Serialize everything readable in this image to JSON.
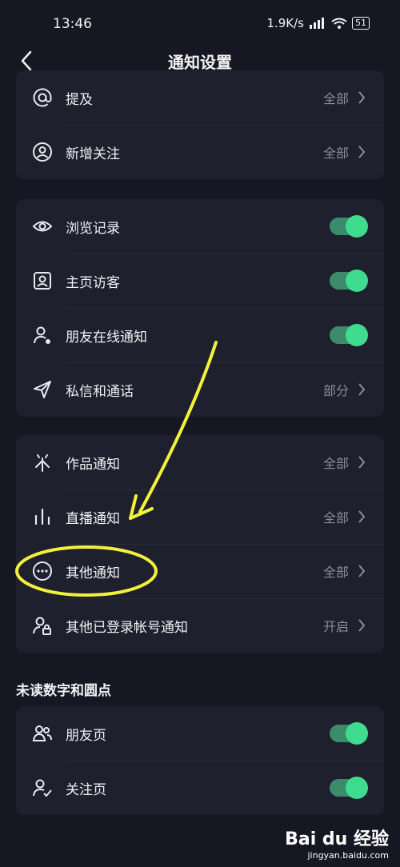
{
  "status": {
    "time": "13:46",
    "speed": "1.9K/s",
    "battery": "51"
  },
  "nav": {
    "title": "通知设置"
  },
  "group1": [
    {
      "label": "提及",
      "value": "全部",
      "icon": "at-icon"
    },
    {
      "label": "新增关注",
      "value": "全部",
      "icon": "user-circle-icon"
    }
  ],
  "group2": [
    {
      "label": "浏览记录",
      "toggle": true,
      "icon": "eye-icon"
    },
    {
      "label": "主页访客",
      "toggle": true,
      "icon": "profile-card-icon"
    },
    {
      "label": "朋友在线通知",
      "toggle": true,
      "icon": "user-dot-icon"
    },
    {
      "label": "私信和通话",
      "value": "部分",
      "icon": "send-icon"
    }
  ],
  "group3": [
    {
      "label": "作品通知",
      "value": "全部",
      "icon": "sparkle-icon"
    },
    {
      "label": "直播通知",
      "value": "全部",
      "icon": "bars-icon"
    },
    {
      "label": "其他通知",
      "value": "全部",
      "icon": "more-circle-icon"
    },
    {
      "label": "其他已登录帐号通知",
      "value": "开启",
      "icon": "user-lock-icon"
    }
  ],
  "section": {
    "title": "未读数字和圆点"
  },
  "group4": [
    {
      "label": "朋友页",
      "toggle": true,
      "icon": "users-icon"
    },
    {
      "label": "关注页",
      "toggle": true,
      "icon": "user-check-icon"
    }
  ],
  "watermark": {
    "logo": "Bai du 经验",
    "url": "jingyan.baidu.com"
  },
  "colors": {
    "background": "#161722",
    "card": "#1f202e",
    "toggle_on": "#3fdc8f",
    "annotation": "#f2f23a"
  }
}
